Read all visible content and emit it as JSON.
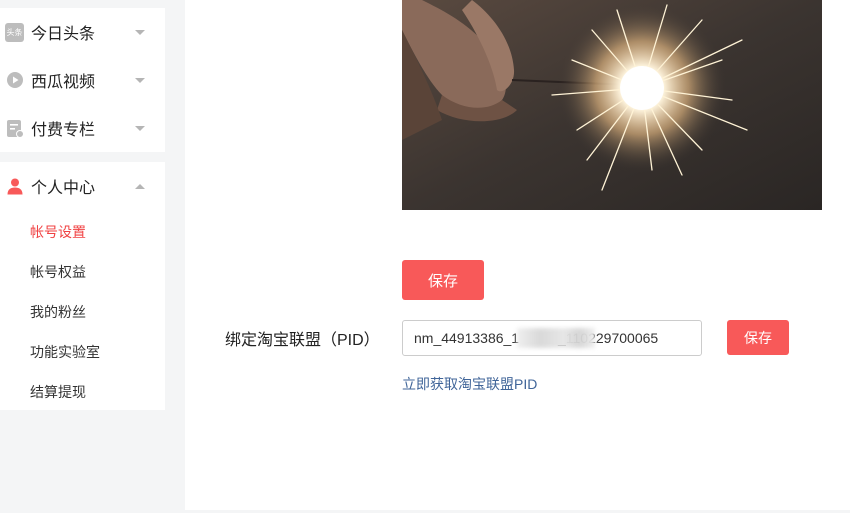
{
  "sidebar": {
    "top_items": [
      {
        "label": "今日头条",
        "icon": "toutiao-icon",
        "icon_text": "头条"
      },
      {
        "label": "西瓜视频",
        "icon": "xigua-video-icon"
      },
      {
        "label": "付费专栏",
        "icon": "paid-column-icon"
      }
    ],
    "personal": {
      "label": "个人中心",
      "icon": "user-icon",
      "sub_items": [
        {
          "label": "帐号设置",
          "active": true
        },
        {
          "label": "帐号权益",
          "active": false
        },
        {
          "label": "我的粉丝",
          "active": false
        },
        {
          "label": "功能实验室",
          "active": false
        },
        {
          "label": "结算提现",
          "active": false
        }
      ]
    }
  },
  "main": {
    "save_label": "保存",
    "pid": {
      "label": "绑定淘宝联盟（PID）",
      "value": "nm_44913386_1          _110229700065",
      "save_label": "保存",
      "link_text": "立即获取淘宝联盟PID"
    }
  },
  "colors": {
    "accent": "#f85959",
    "active_text": "#f04142",
    "link": "#406599",
    "background": "#f4f5f6"
  }
}
